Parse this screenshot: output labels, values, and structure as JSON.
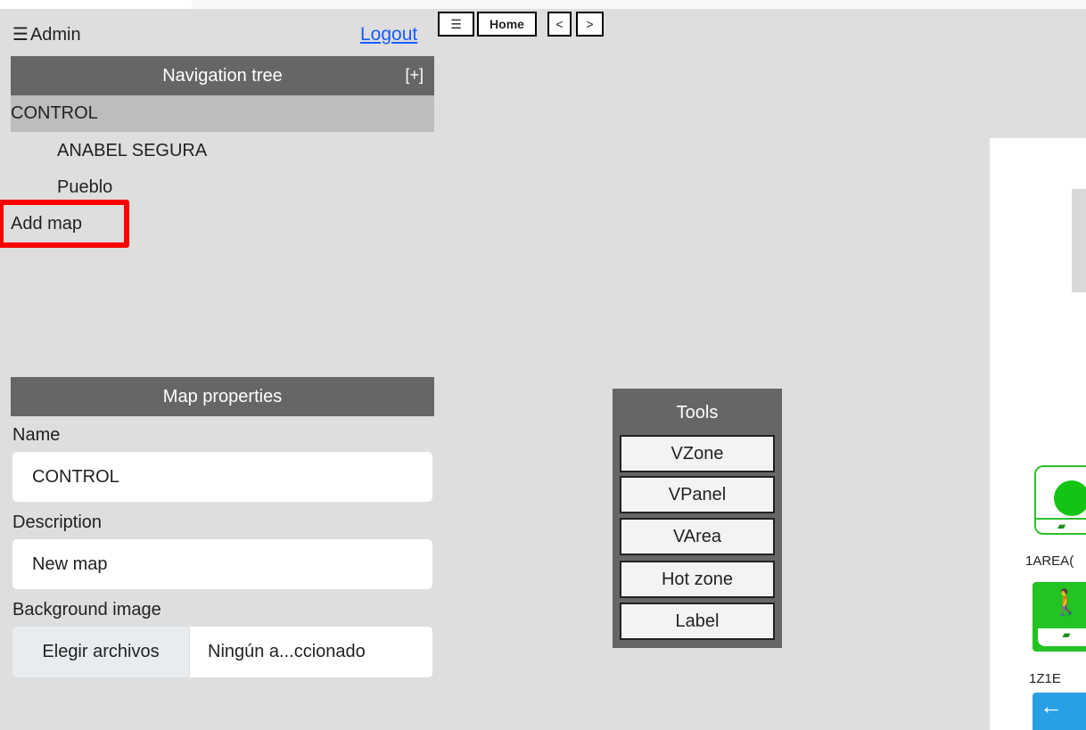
{
  "header": {
    "menu_icon_glyph": "☰",
    "app_user": "Admin",
    "logout_label": "Logout"
  },
  "toolbar": {
    "menu_glyph": "☰",
    "home_label": "Home",
    "prev_label": "<",
    "next_label": ">"
  },
  "navigation": {
    "title": "Navigation tree",
    "expand_label": "[+]",
    "root": "CONTROL",
    "children": [
      "ANABEL SEGURA",
      "Pueblo"
    ],
    "add_map_label": "Add map"
  },
  "map_properties": {
    "title": "Map properties",
    "name_label": "Name",
    "name_value": "CONTROL",
    "description_label": "Description",
    "description_value": "New map",
    "background_label": "Background image",
    "file_button_label": "Elegir archivos",
    "file_status": "Ningún a...ccionado"
  },
  "tools": {
    "title": "Tools",
    "buttons": [
      "VZone",
      "VPanel",
      "VArea",
      "Hot zone",
      "Label"
    ]
  },
  "canvas": {
    "item1_label": "1AREA(",
    "item2_label": "1Z1E",
    "item1_icon": "green-status-icon",
    "item2_icon": "running-man-icon",
    "item3_icon": "exit-arrow-icon"
  },
  "colors": {
    "panel_header": "#666666",
    "tree_selected": "#bdbdbd",
    "app_background": "#dedede",
    "link": "#1a5cff",
    "highlight": "#ff0000",
    "status_green": "#22c322",
    "status_blue": "#29a0e6"
  }
}
